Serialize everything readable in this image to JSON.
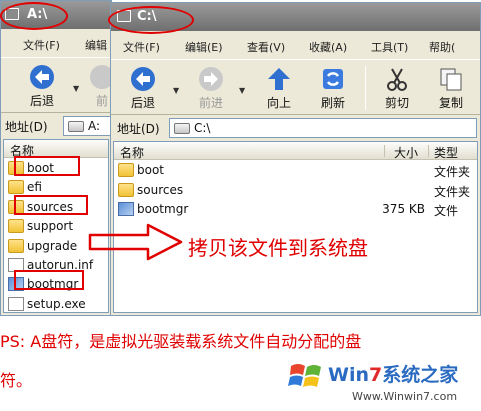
{
  "window_a": {
    "title": "A:\\",
    "menu": {
      "file": "文件(F)",
      "edit": "编辑"
    },
    "toolbar": {
      "back": "后退",
      "forward": "前"
    },
    "address": {
      "label": "地址(D)",
      "value": "A:"
    },
    "columns": {
      "name": "名称"
    },
    "files": [
      {
        "name": "boot",
        "kind": "folder"
      },
      {
        "name": "efi",
        "kind": "folder"
      },
      {
        "name": "sources",
        "kind": "folder"
      },
      {
        "name": "support",
        "kind": "folder"
      },
      {
        "name": "upgrade",
        "kind": "folder"
      },
      {
        "name": "autorun.inf",
        "kind": "file"
      },
      {
        "name": "bootmgr",
        "kind": "system"
      },
      {
        "name": "setup.exe",
        "kind": "exe"
      }
    ]
  },
  "window_c": {
    "title": "C:\\",
    "menu": {
      "file": "文件(F)",
      "edit": "编辑(E)",
      "view": "查看(V)",
      "favorites": "收藏(A)",
      "tools": "工具(T)",
      "help": "帮助("
    },
    "toolbar": {
      "back": "后退",
      "forward": "前进",
      "up": "向上",
      "refresh": "刷新",
      "cut": "剪切",
      "copy": "复制"
    },
    "address": {
      "label": "地址(D)",
      "value": "C:\\"
    },
    "columns": {
      "name": "名称",
      "size": "大小",
      "type": "类型"
    },
    "files": [
      {
        "name": "boot",
        "size": "",
        "type": "文件夹",
        "kind": "folder"
      },
      {
        "name": "sources",
        "size": "",
        "type": "文件夹",
        "kind": "folder"
      },
      {
        "name": "bootmgr",
        "size": "375 KB",
        "type": "文件",
        "kind": "system"
      }
    ]
  },
  "annotations": {
    "main": "拷贝该文件到系统盘",
    "ps_line1": "PS: A盘符，是虚拟光驱装载系统文件自动分配的盘",
    "ps_line2": "符。"
  },
  "logo": {
    "brand_prefix": "Win",
    "brand_number": "7",
    "brand_suffix": "系统之家",
    "site": "Www.Winwin7.com"
  },
  "colors": {
    "highlight": "#e00000",
    "title_bar": "#7f7f7f",
    "window_bg": "#ece9d8",
    "brand_blue": "#2a6bc1"
  }
}
